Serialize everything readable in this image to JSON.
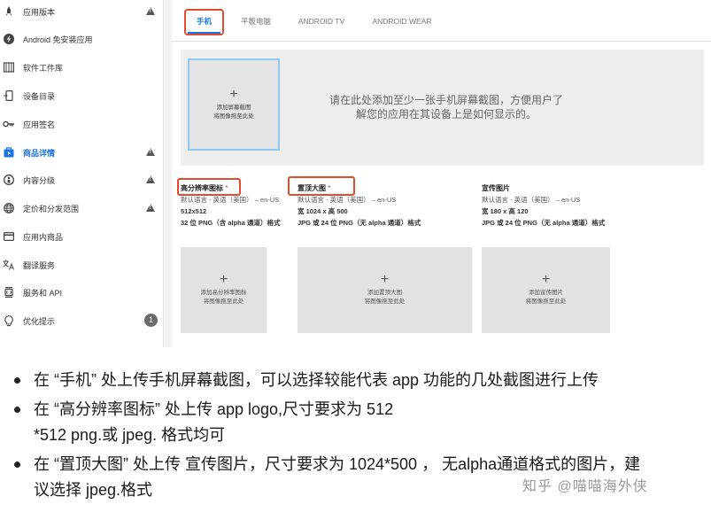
{
  "sidebar": {
    "items": [
      {
        "label": "应用版本",
        "icon": "rocket-icon",
        "status": "warning"
      },
      {
        "label": "Android 免安装应用",
        "icon": "bolt-icon",
        "status": ""
      },
      {
        "label": "软件工件库",
        "icon": "library-icon",
        "status": ""
      },
      {
        "label": "设备目录",
        "icon": "device-catalog-icon",
        "status": ""
      },
      {
        "label": "应用签名",
        "icon": "key-icon",
        "status": ""
      },
      {
        "label": "商品详情",
        "icon": "store-listing-icon",
        "status": "warning",
        "active": true
      },
      {
        "label": "内容分级",
        "icon": "rating-icon",
        "status": "warning"
      },
      {
        "label": "定价和分发范围",
        "icon": "globe-icon",
        "status": "warning"
      },
      {
        "label": "应用内商品",
        "icon": "card-icon",
        "status": ""
      },
      {
        "label": "翻译服务",
        "icon": "translate-icon",
        "status": ""
      },
      {
        "label": "服务和 API",
        "icon": "api-icon",
        "status": ""
      },
      {
        "label": "优化提示",
        "icon": "lightbulb-icon",
        "status": "badge",
        "badge": "1"
      }
    ]
  },
  "tabs": [
    {
      "label": "手机",
      "active": true
    },
    {
      "label": "平板电脑"
    },
    {
      "label": "ANDROID TV"
    },
    {
      "label": "ANDROID WEAR"
    }
  ],
  "screenshots": {
    "add_label": "添加屏幕截图",
    "drag_label": "将图像拖至此处",
    "hint_line1": "请在此处添加至少一张手机屏幕截图，方便用户了",
    "hint_line2": "解您的应用在其设备上是如何显示的。"
  },
  "assets": [
    {
      "title": "高分辨率图标",
      "required": "*",
      "lang": "默认语言 - 英语（美国） – en-US",
      "size": "512x512",
      "format": "32 位 PNG（含 alpha 通道）格式",
      "drop_add": "添加高分辨率图标",
      "drop_drag": "将图像拖至此处"
    },
    {
      "title": "置顶大图",
      "required": "*",
      "lang": "默认语言 - 英语（美国） – en-US",
      "size": "宽 1024 x 高 500",
      "format": "JPG 或 24 位 PNG（无 alpha 通道）格式",
      "drop_add": "添加置顶大图",
      "drop_drag": "将图像拖至此处"
    },
    {
      "title": "宣传图片",
      "required": "",
      "lang": "默认语言 - 英语（美国） – en-US",
      "size": "宽 180 x 高 120",
      "format": "JPG 或 24 位 PNG（无 alpha 通道）格式",
      "drop_add": "添加宣传图片",
      "drop_drag": "将图像拖至此处"
    }
  ],
  "notes": [
    {
      "line1": "在 “手机” 处上传手机屏幕截图，可以选择较能代表 app 功能的几处截图进行上传"
    },
    {
      "line1": "在 “高分辨率图标” 处上传 app logo,尺寸要求为 512",
      "line2": "*512 png.或 jpeg. 格式均可"
    },
    {
      "line1": "在 “置顶大图” 处上传 宣传图片，尺寸要求为 1024*500 ， 无alpha通道格式的图片，建",
      "line2": "议选择 jpeg.格式"
    }
  ],
  "watermark": "知乎 @喵喵海外侠",
  "colors": {
    "accent": "#1a73e8",
    "highlight_frame": "#e24b2d",
    "warning": "#555555"
  }
}
